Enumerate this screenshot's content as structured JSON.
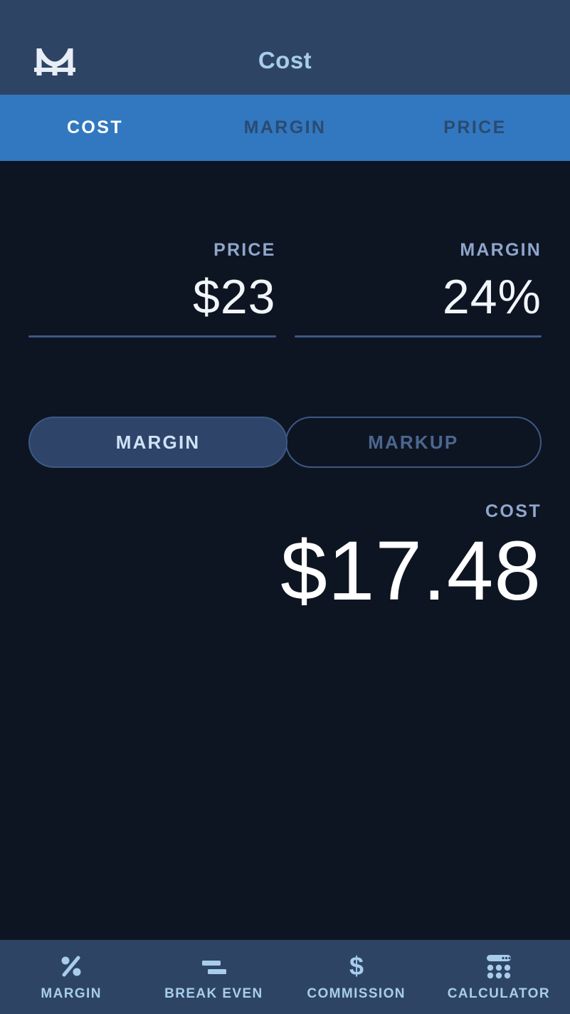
{
  "header": {
    "title": "Cost",
    "logo_icon": "bridge-m-logo-icon"
  },
  "tabstrip": {
    "tabs": [
      {
        "label": "COST",
        "active": true
      },
      {
        "label": "MARGIN",
        "active": false
      },
      {
        "label": "PRICE",
        "active": false
      }
    ]
  },
  "inputs": {
    "price": {
      "label": "PRICE",
      "value": "$23"
    },
    "margin": {
      "label": "MARGIN",
      "value": "24%"
    }
  },
  "segmented": {
    "options": [
      {
        "label": "MARGIN",
        "selected": true
      },
      {
        "label": "MARKUP",
        "selected": false
      }
    ]
  },
  "result": {
    "label": "COST",
    "value": "$17.48"
  },
  "bottomnav": {
    "items": [
      {
        "label": "MARGIN",
        "icon": "percent-icon"
      },
      {
        "label": "BREAK EVEN",
        "icon": "equals-icon"
      },
      {
        "label": "COMMISSION",
        "icon": "dollar-icon"
      },
      {
        "label": "CALCULATOR",
        "icon": "calculator-icon"
      }
    ]
  },
  "colors": {
    "header_bg": "#2e4465",
    "tabstrip_bg": "#3278c0",
    "body_bg": "#0e1522",
    "accent_light_blue": "#a8cdec",
    "label_blue": "#8fa6cc",
    "selected_pill": "#2e4468",
    "outline": "#3d5883"
  }
}
